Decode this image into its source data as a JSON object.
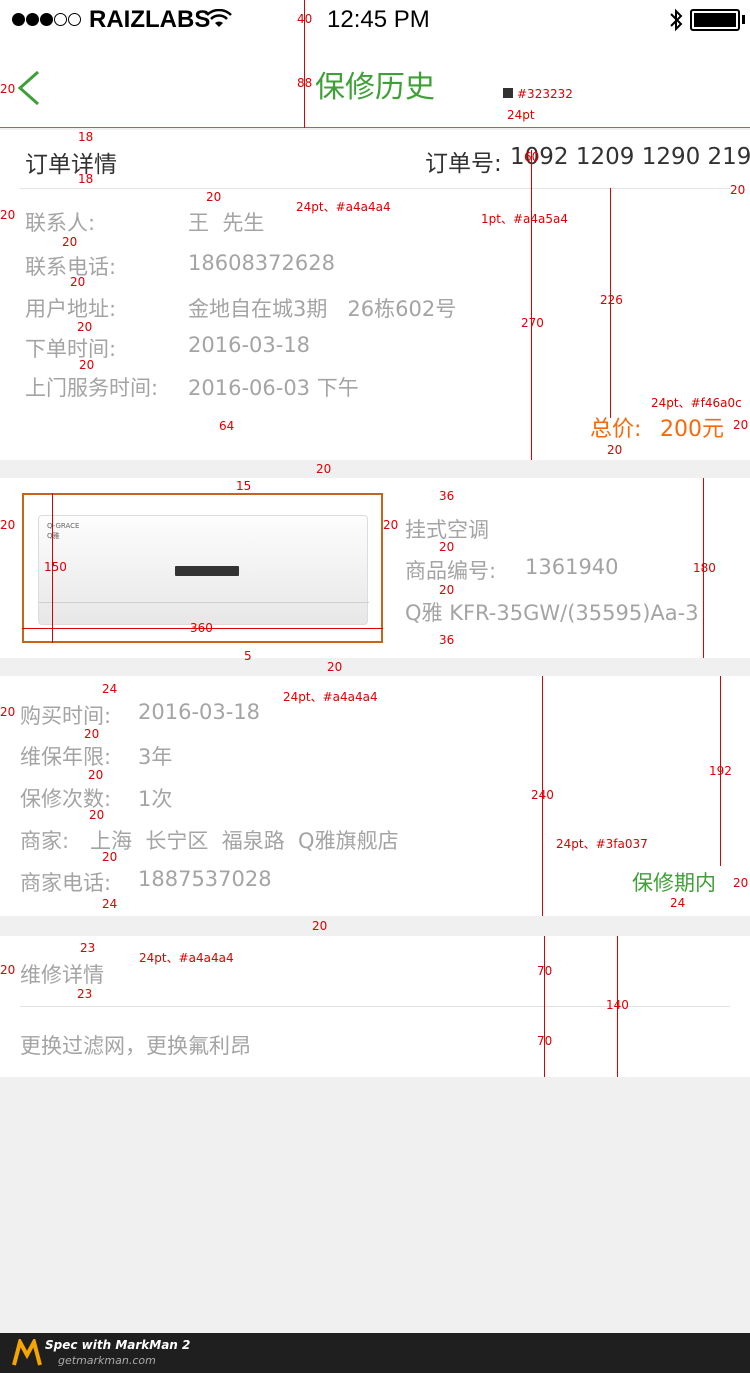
{
  "status_bar": {
    "carrier": "RAIZLABS",
    "time": "12:45 PM"
  },
  "nav": {
    "title": "保修历史"
  },
  "order": {
    "heading": "订单详情",
    "number_label": "订单号:",
    "number": "1092 1209 1290 219",
    "contact_label": "联系人:",
    "contact": "王  先生",
    "phone_label": "联系电话:",
    "phone": "18608372628",
    "address_label": "用户地址:",
    "address": "金地自在城3期   26栋602号",
    "order_date_label": "下单时间:",
    "order_date": "2016-03-18",
    "service_time_label": "上门服务时间:",
    "service_time": "2016-06-03 下午",
    "total_label": "总价:",
    "total": "200元"
  },
  "product": {
    "name": "挂式空调",
    "code_label": "商品编号:",
    "code": "1361940",
    "model": "Q雅 KFR-35GW/(35595)Aa-3",
    "image_brand": "Q-GRACE",
    "image_brand_cn": "Q雅"
  },
  "warranty": {
    "purchase_label": "购买时间:",
    "purchase_date": "2016-03-18",
    "period_label": "维保年限:",
    "period": "3年",
    "repair_count_label": "保修次数:",
    "repair_count": "1次",
    "merchant_label": "商家:",
    "merchant": "上海  长宁区  福泉路  Q雅旗舰店",
    "merchant_phone_label": "商家电话:",
    "merchant_phone": "1887537028",
    "status": "保修期内"
  },
  "repair": {
    "heading": "维修详情",
    "detail": "更换过滤网，更换氟利昂"
  },
  "spec_annotations": {
    "color_title": "#323232",
    "font_title": "24pt",
    "font_gray": "24pt、#a4a4a4",
    "divider": "1pt、#a4a5a4",
    "font_price": "24pt、#f46a0c",
    "font_status": "24pt、#3fa037",
    "font_purchase": "24pt、#a4a4a4",
    "font_repair": "24pt、#a4a4a4"
  },
  "footer": {
    "brand": "Spec with MarkMan 2",
    "url": "getmarkman.com"
  },
  "colors": {
    "green": "#3fa037",
    "orange": "#f46a0c",
    "gray": "#a4a4a4",
    "dark": "#323232",
    "box": "#c8651b"
  }
}
